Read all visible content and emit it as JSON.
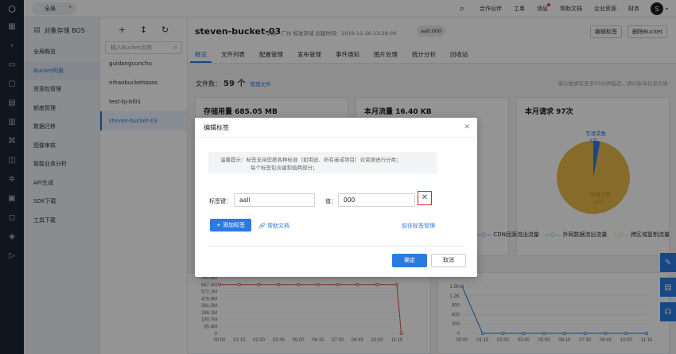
{
  "topbar": {
    "region": "全局",
    "nav": [
      "合作伙伴",
      "工单",
      "消息",
      "帮助文档",
      "企业资源",
      "财务"
    ],
    "avatar": "S"
  },
  "leftnav": {
    "title": "对象存储 BOS",
    "items": [
      "全局概览",
      "Bucket列表",
      "资源包管理",
      "额度管理",
      "数据迁移",
      "图像审核",
      "智能业务分析",
      "API生成",
      "SDK下载",
      "工具下载"
    ],
    "active_index": 1
  },
  "buckets": {
    "search_placeholder": "输入Bucket名称",
    "items": [
      "guidangcunchu",
      "nihaobucketsssss",
      "test-bj-bl01",
      "steven-bucket-03"
    ],
    "active_index": 3
  },
  "bucket": {
    "name": "steven-bucket-03",
    "meta": "华南 - 广州   标准存储   创建时间：2019-11-26 13:29:09",
    "tag": "aall:000",
    "edit_tag_btn": "编辑标签",
    "delete_btn": "删除Bucket",
    "tabs": [
      "概览",
      "文件列表",
      "配置管理",
      "发布管理",
      "事件通知",
      "图片处理",
      "统计分析",
      "回收站"
    ],
    "active_tab": 0
  },
  "overview": {
    "file_count_label": "文件数：",
    "file_count": "59 个",
    "manage_link": "管理文件",
    "hint": "展示数据有至多20分钟延迟，请以账单信息为准",
    "storage_card": "存储用量 685.05 MB",
    "traffic_card": "本月流量 16.40 KB",
    "requests_card": "本月请求 97次",
    "pie_write_label": "写请求数",
    "pie_write_value": "3次",
    "pie_read_label": "读请求数",
    "pie_read_value": "94次",
    "legend_items": [
      "CDN回源流出流量",
      "外网数据流出流量",
      "跨区域复制流量"
    ]
  },
  "charts": {
    "left_yticks": [
      "762.9M",
      "667.6M",
      "572.2M",
      "476.8M",
      "381.5M",
      "286.1M",
      "190.7M",
      "95.4M",
      "0"
    ],
    "right_yticks": [
      "1.5K",
      "1.2K",
      "900",
      "600",
      "300",
      "0"
    ],
    "xticks": [
      "00:00",
      "01:15",
      "02:30",
      "03:45",
      "05:00",
      "06:15",
      "07:30",
      "08:45",
      "10:00",
      "11:15"
    ],
    "left_series": [
      667.6,
      667.6,
      667.6,
      667.6,
      667.6,
      667.6,
      667.6,
      667.6,
      667.6,
      667.6,
      0
    ],
    "right_series": [
      1500,
      0,
      0,
      0,
      0,
      0,
      0,
      0,
      0,
      0
    ]
  },
  "modal": {
    "title": "编辑标签",
    "notice_line1": "温馨提示：标签支持您按各种标准（如用途、所有者或项目）对资源进行分类；",
    "notice_line2": "每个标签包含键和值两部分；",
    "key_label": "标签键：",
    "key_value": "aall",
    "value_label": "值：",
    "value_value": "000",
    "add_btn": "+ 添加标签",
    "doc_link": "帮助文档",
    "mgr_link": "前往标签管理",
    "ok": "确定",
    "cancel": "取消"
  },
  "colors": {
    "accent": "#2a7ae2",
    "highlight_box": "#e02020",
    "pie_gold": "#e8b84a",
    "pie_blue": "#2a7ae2",
    "series_red": "#d0504a"
  }
}
